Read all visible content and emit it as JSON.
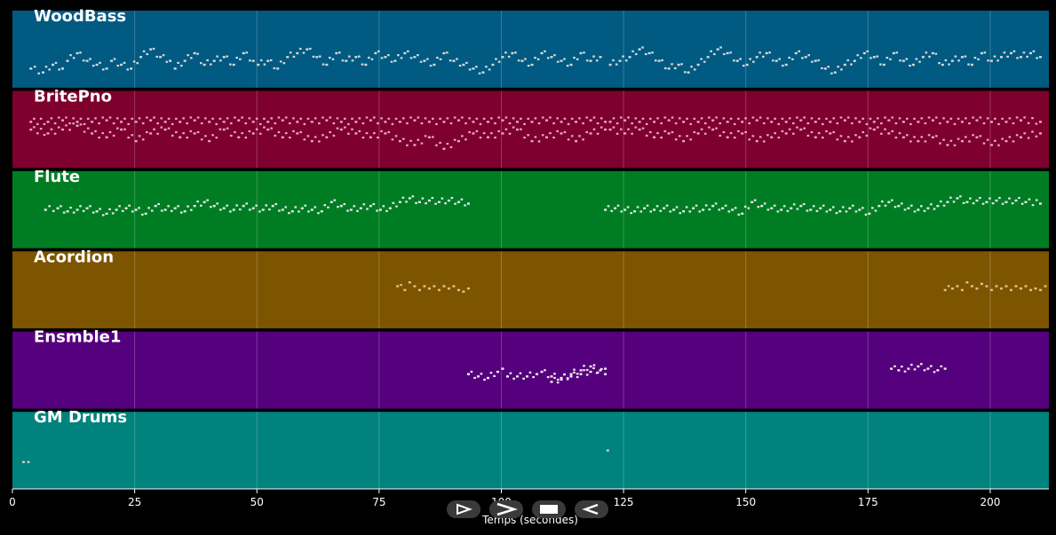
{
  "chart_data": {
    "type": "piano-roll",
    "x_axis": {
      "label": "Temps (secondes)",
      "ticks": [
        0,
        25,
        50,
        75,
        100,
        125,
        150,
        175,
        200
      ],
      "xlim": [
        0,
        212
      ]
    },
    "tracks": [
      {
        "name": "WoodBass",
        "color": "#005a82",
        "note_color": "#d8d8d8",
        "segments": [
          {
            "x": [
              3.5,
              6,
              8,
              10,
              11,
              13,
              15,
              17,
              19,
              20,
              22,
              24,
              26,
              28,
              30,
              32,
              33,
              35,
              37,
              39,
              41,
              43,
              45,
              47,
              49
            ],
            "y": [
              0.25,
              0.2,
              0.3,
              0.25,
              0.35,
              0.45,
              0.35,
              0.3,
              0.25,
              0.35,
              0.3,
              0.25,
              0.4,
              0.5,
              0.4,
              0.35,
              0.25,
              0.35,
              0.45,
              0.3,
              0.35,
              0.4,
              0.3,
              0.45,
              0.35
            ]
          },
          {
            "x": [
              50,
              52,
              54,
              56,
              58,
              60,
              62,
              64,
              66,
              68,
              70,
              72,
              74,
              76,
              78,
              80,
              82,
              84,
              86,
              88,
              90,
              92,
              94,
              96,
              98,
              100,
              102,
              104,
              106,
              108,
              110,
              112,
              114,
              116,
              118,
              120
            ],
            "y": [
              0.3,
              0.35,
              0.25,
              0.4,
              0.45,
              0.5,
              0.4,
              0.3,
              0.45,
              0.35,
              0.4,
              0.3,
              0.45,
              0.4,
              0.35,
              0.45,
              0.4,
              0.35,
              0.3,
              0.45,
              0.35,
              0.3,
              0.25,
              0.2,
              0.3,
              0.4,
              0.45,
              0.35,
              0.3,
              0.45,
              0.4,
              0.35,
              0.3,
              0.45,
              0.35,
              0.4
            ]
          },
          {
            "x": [
              122,
              124,
              126,
              128,
              130,
              132,
              134,
              136,
              138,
              140,
              142,
              144,
              146,
              148,
              150,
              152,
              154,
              156,
              158,
              160,
              162,
              164,
              166,
              168,
              170,
              172,
              174,
              176,
              178,
              180,
              182,
              184,
              186,
              188,
              190,
              192,
              194,
              196,
              198,
              200,
              202,
              204,
              206,
              208,
              210
            ],
            "y": [
              0.3,
              0.35,
              0.4,
              0.5,
              0.45,
              0.35,
              0.25,
              0.3,
              0.2,
              0.3,
              0.4,
              0.5,
              0.45,
              0.35,
              0.3,
              0.4,
              0.45,
              0.35,
              0.3,
              0.45,
              0.4,
              0.35,
              0.25,
              0.2,
              0.3,
              0.35,
              0.45,
              0.4,
              0.3,
              0.45,
              0.35,
              0.3,
              0.4,
              0.45,
              0.3,
              0.35,
              0.4,
              0.3,
              0.45,
              0.35,
              0.4,
              0.45,
              0.4,
              0.45,
              0.4
            ]
          }
        ]
      },
      {
        "name": "BritePno",
        "color": "#7d002d",
        "note_color": "#e8a8c0",
        "segments": [
          {
            "x": [
              3.5,
              7,
              10,
              13,
              16,
              19,
              22,
              25,
              28,
              31,
              34,
              37,
              40,
              43,
              46,
              49,
              52,
              55,
              58,
              61,
              64,
              67,
              70,
              73,
              76,
              79,
              82,
              85,
              88,
              91,
              94,
              97,
              100,
              103,
              106,
              109,
              112,
              115,
              118,
              121
            ],
            "y": [
              0.5,
              0.45,
              0.5,
              0.55,
              0.45,
              0.4,
              0.5,
              0.35,
              0.45,
              0.5,
              0.4,
              0.45,
              0.35,
              0.5,
              0.4,
              0.45,
              0.5,
              0.4,
              0.45,
              0.35,
              0.4,
              0.5,
              0.45,
              0.4,
              0.45,
              0.35,
              0.3,
              0.4,
              0.25,
              0.35,
              0.45,
              0.4,
              0.45,
              0.5,
              0.35,
              0.4,
              0.45,
              0.35,
              0.45,
              0.5
            ]
          },
          {
            "x": [
              3.5,
              7,
              10,
              13,
              16,
              19,
              22,
              25,
              28,
              31,
              34,
              37,
              40,
              43,
              46,
              49,
              52,
              55,
              58,
              61,
              64,
              67,
              70,
              73,
              76,
              79,
              82,
              85,
              88,
              91,
              94,
              97,
              100,
              103,
              106,
              109,
              112,
              115,
              118,
              121
            ],
            "y": [
              0.6,
              0.6,
              0.62,
              0.6,
              0.6,
              0.62,
              0.6,
              0.6,
              0.62,
              0.6,
              0.6,
              0.62,
              0.6,
              0.6,
              0.62,
              0.6,
              0.6,
              0.62,
              0.6,
              0.6,
              0.62,
              0.6,
              0.6,
              0.62,
              0.6,
              0.6,
              0.62,
              0.6,
              0.6,
              0.62,
              0.6,
              0.6,
              0.62,
              0.6,
              0.6,
              0.62,
              0.6,
              0.6,
              0.62,
              0.6
            ]
          },
          {
            "x": [
              122,
              125,
              128,
              131,
              134,
              137,
              140,
              143,
              146,
              149,
              152,
              155,
              158,
              161,
              164,
              167,
              170,
              173,
              176,
              179,
              182,
              185,
              188,
              191,
              194,
              197,
              200,
              203,
              206,
              210
            ],
            "y": [
              0.5,
              0.45,
              0.5,
              0.4,
              0.45,
              0.35,
              0.45,
              0.5,
              0.4,
              0.45,
              0.35,
              0.4,
              0.45,
              0.5,
              0.4,
              0.45,
              0.35,
              0.4,
              0.5,
              0.45,
              0.4,
              0.35,
              0.4,
              0.3,
              0.35,
              0.4,
              0.3,
              0.35,
              0.4,
              0.45
            ]
          },
          {
            "x": [
              122,
              125,
              128,
              131,
              134,
              137,
              140,
              143,
              146,
              149,
              152,
              155,
              158,
              161,
              164,
              167,
              170,
              173,
              176,
              179,
              182,
              185,
              188,
              191,
              194,
              197,
              200,
              203,
              206,
              210
            ],
            "y": [
              0.6,
              0.62,
              0.6,
              0.6,
              0.62,
              0.6,
              0.6,
              0.62,
              0.6,
              0.6,
              0.62,
              0.6,
              0.6,
              0.62,
              0.6,
              0.6,
              0.62,
              0.6,
              0.6,
              0.62,
              0.6,
              0.6,
              0.62,
              0.6,
              0.6,
              0.62,
              0.6,
              0.6,
              0.62,
              0.6
            ]
          }
        ]
      },
      {
        "name": "Flute",
        "color": "#007d23",
        "note_color": "#e8e8e8",
        "segments": [
          {
            "x": [
              6.5,
              9,
              11,
              13,
              15,
              17,
              19,
              21,
              23,
              25,
              27,
              29,
              31,
              33,
              35,
              37,
              39,
              41,
              43,
              45,
              47,
              49,
              51,
              53,
              55,
              57,
              59,
              61,
              63,
              65,
              67,
              69,
              71,
              73,
              75,
              77,
              79,
              81,
              83,
              85,
              87,
              89,
              91,
              93
            ],
            "y": [
              0.5,
              0.52,
              0.48,
              0.5,
              0.52,
              0.48,
              0.45,
              0.5,
              0.52,
              0.5,
              0.45,
              0.55,
              0.5,
              0.52,
              0.48,
              0.55,
              0.6,
              0.55,
              0.52,
              0.5,
              0.55,
              0.52,
              0.5,
              0.55,
              0.5,
              0.48,
              0.52,
              0.5,
              0.48,
              0.6,
              0.55,
              0.5,
              0.52,
              0.55,
              0.5,
              0.52,
              0.6,
              0.65,
              0.6,
              0.62,
              0.6,
              0.62,
              0.6,
              0.58
            ]
          },
          {
            "x": [
              121,
              123,
              125,
              127,
              129,
              131,
              133,
              135,
              137,
              139,
              141,
              143,
              145,
              147,
              149,
              151,
              153,
              155,
              157,
              159,
              161,
              163,
              165,
              167,
              169,
              171,
              173,
              175,
              177,
              179,
              181,
              183,
              185,
              187,
              189,
              191,
              193,
              195,
              197,
              199,
              201,
              203,
              205,
              207,
              210
            ],
            "y": [
              0.5,
              0.52,
              0.5,
              0.48,
              0.52,
              0.5,
              0.52,
              0.5,
              0.48,
              0.52,
              0.5,
              0.55,
              0.52,
              0.5,
              0.45,
              0.6,
              0.55,
              0.52,
              0.5,
              0.52,
              0.55,
              0.5,
              0.52,
              0.5,
              0.48,
              0.52,
              0.5,
              0.45,
              0.55,
              0.6,
              0.55,
              0.52,
              0.5,
              0.52,
              0.55,
              0.6,
              0.65,
              0.6,
              0.62,
              0.6,
              0.62,
              0.6,
              0.62,
              0.6,
              0.58
            ]
          }
        ]
      },
      {
        "name": "Acordion",
        "color": "#7d5500",
        "note_color": "#e0c090",
        "segments": [
          {
            "x": [
              78.5,
              80,
              81,
              82,
              83,
              84,
              85,
              86,
              87,
              88,
              89,
              90,
              91,
              92,
              93
            ],
            "y": [
              0.55,
              0.5,
              0.6,
              0.55,
              0.5,
              0.55,
              0.52,
              0.55,
              0.5,
              0.55,
              0.52,
              0.55,
              0.5,
              0.48,
              0.52
            ]
          },
          {
            "x": [
              190.5,
              192,
              193,
              194,
              195,
              196,
              197,
              198,
              199,
              200,
              201,
              202,
              203,
              204,
              205,
              206,
              207,
              208,
              209,
              210,
              211
            ],
            "y": [
              0.5,
              0.52,
              0.55,
              0.5,
              0.6,
              0.55,
              0.52,
              0.58,
              0.55,
              0.5,
              0.55,
              0.52,
              0.55,
              0.5,
              0.55,
              0.52,
              0.55,
              0.5,
              0.52,
              0.5,
              0.55
            ]
          }
        ]
      },
      {
        "name": "Ensmble1",
        "color": "#55007d",
        "note_color": "#f0f0f0",
        "segments": [
          {
            "x": [
              93,
              95,
              97,
              99,
              100,
              101,
              103,
              105,
              107,
              108,
              110,
              112,
              114,
              116,
              118,
              120,
              121
            ],
            "y": [
              0.45,
              0.42,
              0.4,
              0.48,
              0.52,
              0.42,
              0.42,
              0.42,
              0.45,
              0.48,
              0.42,
              0.4,
              0.42,
              0.45,
              0.48,
              0.5,
              0.52
            ]
          },
          {
            "x": [
              110,
              112,
              114,
              116,
              118,
              121
            ],
            "y": [
              0.35,
              0.38,
              0.45,
              0.5,
              0.55,
              0.45
            ]
          },
          {
            "x": [
              179.5,
              181,
              183,
              185,
              187,
              189,
              190.5
            ],
            "y": [
              0.52,
              0.5,
              0.52,
              0.55,
              0.52,
              0.5,
              0.52
            ]
          }
        ]
      },
      {
        "name": "GM Drums",
        "color": "#00827d",
        "note_color": "#c8c8c8",
        "segments": [
          {
            "x": [
              2,
              3
            ],
            "y": [
              0.35,
              0.35
            ]
          },
          {
            "x": [
              121.5
            ],
            "y": [
              0.5
            ]
          }
        ]
      }
    ]
  },
  "playback": {
    "play_icon": "play-outline-icon",
    "forward_icon": "fast-forward-icon",
    "stop_icon": "stop-icon",
    "rewind_icon": "rewind-icon"
  }
}
